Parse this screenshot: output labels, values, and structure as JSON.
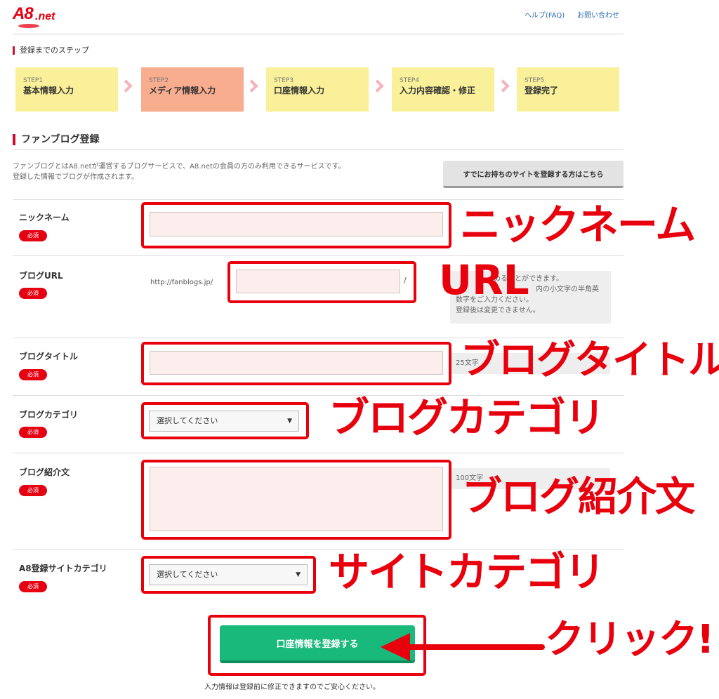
{
  "header": {
    "logo": "A8.net",
    "logo_main": "A8",
    "logo_suffix": ".net",
    "help_link": "ヘルプ(FAQ)",
    "contact_link": "お問い合わせ"
  },
  "steps": {
    "heading": "登録までのステップ",
    "items": [
      {
        "num": "STEP1",
        "label": "基本情報入力",
        "active": false
      },
      {
        "num": "STEP2",
        "label": "メディア情報入力",
        "active": true
      },
      {
        "num": "STEP3",
        "label": "口座情報入力",
        "active": false
      },
      {
        "num": "STEP4",
        "label": "入力内容確認・修正",
        "active": false
      },
      {
        "num": "STEP5",
        "label": "登録完了",
        "active": false
      }
    ]
  },
  "section": {
    "title": "ファンブログ登録",
    "description_line1": "ファンブログとはA8.netが運営するブログサービスで、A8.netの会員の方のみ利用できるサービスです。",
    "description_line2": "登録した情報でブログが作成されます。",
    "existing_site_button": "すでにお持ちのサイトを登録する方はこちら"
  },
  "form": {
    "required_badge": "必須",
    "nickname": {
      "label": "ニックネーム",
      "value": ""
    },
    "blog_url": {
      "label": "ブログURL",
      "prefix": "http://fanblogs.jp/",
      "suffix": "/",
      "value": "",
      "hint_lines": [
        "めることができます。",
        "内の小文字の半角英",
        "数字をご入力ください。",
        "登録後は変更できません。"
      ]
    },
    "blog_title": {
      "label": "ブログタイトル",
      "value": "",
      "hint": "25文字"
    },
    "blog_category": {
      "label": "ブログカテゴリ",
      "selected": "選択してください"
    },
    "blog_intro": {
      "label": "ブログ紹介文",
      "value": "",
      "hint": "100文字"
    },
    "site_category": {
      "label": "A8登録サイトカテゴリ",
      "selected": "選択してください"
    }
  },
  "submit": {
    "button": "口座情報を登録する",
    "note": "入力情報は登録前に修正できますのでご安心ください。"
  },
  "annotations": {
    "nickname": "ニックネーム",
    "url": "URL",
    "blog_title": "ブログタイトル",
    "blog_category": "ブログカテゴリ",
    "blog_intro": "ブログ紹介文",
    "site_category": "サイトカテゴリ",
    "click": "クリック!"
  },
  "colors": {
    "annotation_red": "#e8000d",
    "brand_red": "#e50012",
    "step_yellow": "#faf09a",
    "step_active": "#f8ad8f",
    "submit_green": "#19b87b"
  }
}
